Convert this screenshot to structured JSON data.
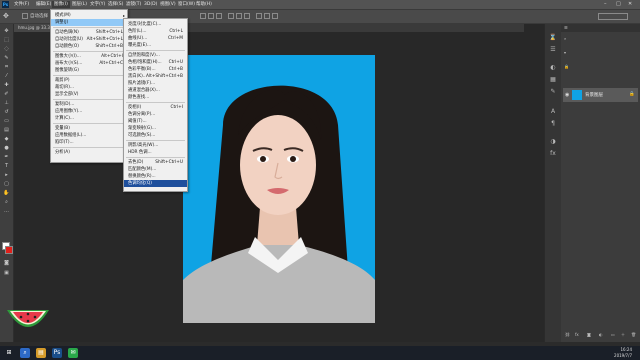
{
  "menubar": {
    "items": [
      "文件(F)",
      "编辑(E)",
      "图像(I)",
      "图层(L)",
      "文字(Y)",
      "选择(S)",
      "滤镜(T)",
      "3D(D)",
      "视图(V)",
      "窗口(W)",
      "帮助(H)"
    ]
  },
  "options_bar": {
    "tool_label": "自动选择"
  },
  "doc_tab": {
    "title": "hmu.jpg @ 33.3%"
  },
  "image_menu": {
    "items": [
      {
        "label": "模式(M)",
        "shortcut": "",
        "sub": true
      },
      {
        "label": "调整(J)",
        "shortcut": "",
        "sub": true
      },
      {
        "label": "自动色调(N)",
        "shortcut": "Shift+Ctrl+L"
      },
      {
        "label": "自动对比度(U)",
        "shortcut": "Alt+Shift+Ctrl+L"
      },
      {
        "label": "自动颜色(O)",
        "shortcut": "Shift+Ctrl+B"
      },
      {
        "label": "图像大小(I)...",
        "shortcut": "Alt+Ctrl+I"
      },
      {
        "label": "画布大小(S)...",
        "shortcut": "Alt+Ctrl+C"
      },
      {
        "label": "图像旋转(G)",
        "shortcut": "",
        "sub": true
      },
      {
        "label": "裁剪(P)",
        "shortcut": ""
      },
      {
        "label": "裁切(R)...",
        "shortcut": ""
      },
      {
        "label": "显示全部(V)",
        "shortcut": ""
      },
      {
        "label": "复制(D)...",
        "shortcut": ""
      },
      {
        "label": "应用图像(Y)...",
        "shortcut": ""
      },
      {
        "label": "计算(C)...",
        "shortcut": ""
      },
      {
        "label": "变量(B)",
        "shortcut": "",
        "sub": true
      },
      {
        "label": "应用数据组(L)...",
        "shortcut": ""
      },
      {
        "label": "陷印(T)...",
        "shortcut": ""
      },
      {
        "label": "分析(A)",
        "shortcut": "",
        "sub": true
      }
    ]
  },
  "adjust_menu": {
    "items": [
      {
        "label": "亮度/对比度(C)...",
        "shortcut": ""
      },
      {
        "label": "色阶(L)...",
        "shortcut": "Ctrl+L"
      },
      {
        "label": "曲线(U)...",
        "shortcut": "Ctrl+M"
      },
      {
        "label": "曝光度(E)...",
        "shortcut": ""
      },
      {
        "label": "自然饱和度(V)...",
        "shortcut": ""
      },
      {
        "label": "色相/饱和度(H)...",
        "shortcut": "Ctrl+U"
      },
      {
        "label": "色彩平衡(B)...",
        "shortcut": "Ctrl+B"
      },
      {
        "label": "黑白(K)...",
        "shortcut": "Alt+Shift+Ctrl+B"
      },
      {
        "label": "照片滤镜(F)...",
        "shortcut": ""
      },
      {
        "label": "通道混合器(X)...",
        "shortcut": ""
      },
      {
        "label": "颜色查找...",
        "shortcut": ""
      },
      {
        "label": "反相(I)",
        "shortcut": "Ctrl+I"
      },
      {
        "label": "色调分离(P)...",
        "shortcut": ""
      },
      {
        "label": "阈值(T)...",
        "shortcut": ""
      },
      {
        "label": "渐变映射(G)...",
        "shortcut": ""
      },
      {
        "label": "可选颜色(S)...",
        "shortcut": ""
      },
      {
        "label": "阴影/高光(W)...",
        "shortcut": ""
      },
      {
        "label": "HDR 色调...",
        "shortcut": ""
      },
      {
        "label": "去色(D)",
        "shortcut": "Shift+Ctrl+U"
      },
      {
        "label": "匹配颜色(M)...",
        "shortcut": ""
      },
      {
        "label": "替换颜色(R)...",
        "shortcut": ""
      },
      {
        "label": "色调均化(Q)",
        "shortcut": ""
      }
    ]
  },
  "layers_panel": {
    "layer_name": "背景图层"
  },
  "taskbar": {
    "time": "16:24",
    "date": "2019/7/7"
  },
  "colors": {
    "canvas_bg": "#0fa3e4",
    "menu_selected": "#1e4f9c",
    "menu_hover": "#91c9f7",
    "foreground": "#ffffff",
    "background": "#e0201b"
  }
}
